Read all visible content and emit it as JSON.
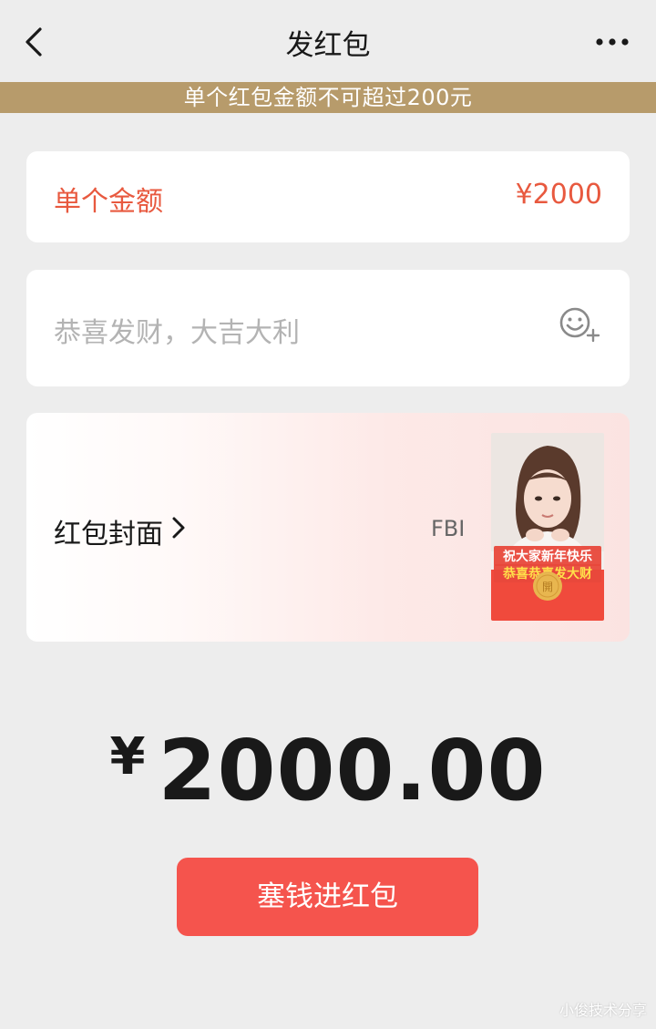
{
  "header": {
    "title": "发红包"
  },
  "notice": "单个红包金额不可超过200元",
  "amount": {
    "label": "单个金额",
    "value": "¥2000"
  },
  "message": {
    "placeholder": "恭喜发财，大吉大利"
  },
  "cover": {
    "label": "红包封面",
    "name": "FBI",
    "thumb_line1": "祝大家新年快乐",
    "thumb_line2": "恭喜恭喜发大财",
    "thumb_badge": "開"
  },
  "total": {
    "currency": "¥",
    "value": "2000.00"
  },
  "submit": {
    "label": "塞钱进红包"
  },
  "watermark": "小俊技术分享",
  "colors": {
    "accent_red": "#f5544d",
    "amount_red": "#e8593f",
    "notice_gold": "#b79b6b"
  }
}
